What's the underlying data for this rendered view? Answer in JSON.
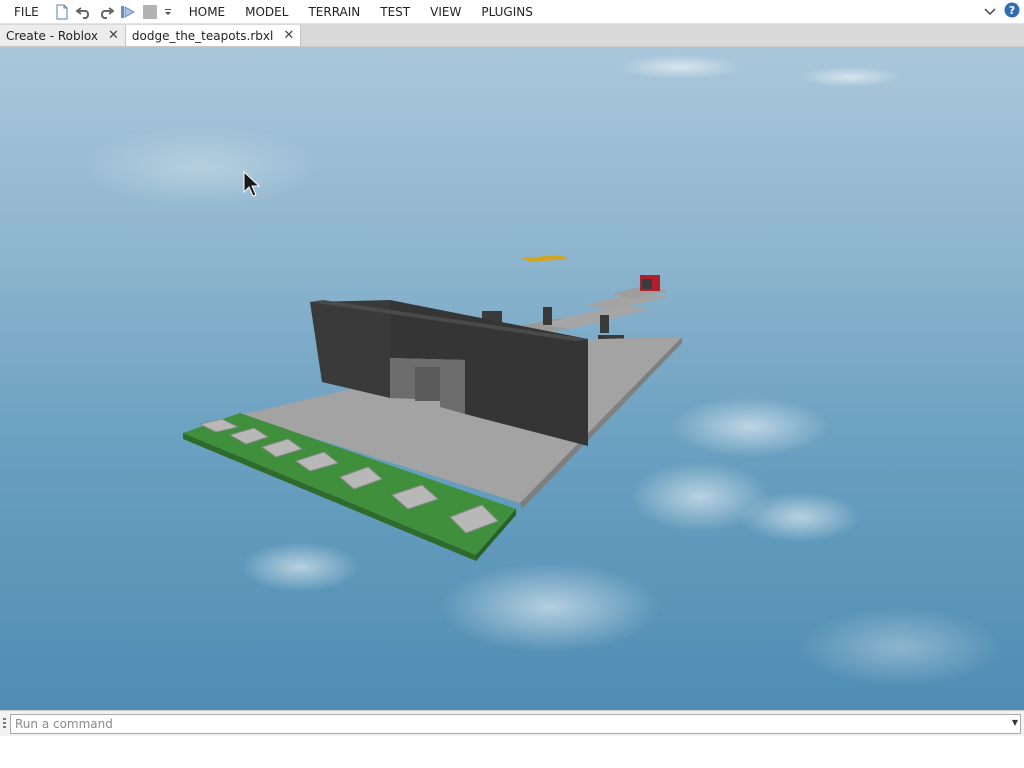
{
  "menubar": {
    "file_label": "FILE",
    "items": [
      "HOME",
      "MODEL",
      "TERRAIN",
      "TEST",
      "VIEW",
      "PLUGINS"
    ],
    "quick_access_icons": [
      "new-file-icon",
      "undo-icon",
      "redo-icon",
      "play-icon",
      "stop-icon",
      "customize-dropdown-icon"
    ],
    "help_icon": "help-icon",
    "collapse_icon": "chevron-down-icon"
  },
  "tabs": [
    {
      "label": "Create - Roblox",
      "active": false
    },
    {
      "label": "dodge_the_teapots.rbxl",
      "active": true
    }
  ],
  "command_bar": {
    "placeholder": "Run a command"
  },
  "colors": {
    "sky_top": "#aac7da",
    "sky_bottom": "#4f8db3",
    "baseplate_gray": "#a3a3a3",
    "wall_dark": "#3c3c3c",
    "spawn_green": "#3f8f3c",
    "accent_yellow": "#d2a521",
    "accent_red": "#b0202a"
  }
}
